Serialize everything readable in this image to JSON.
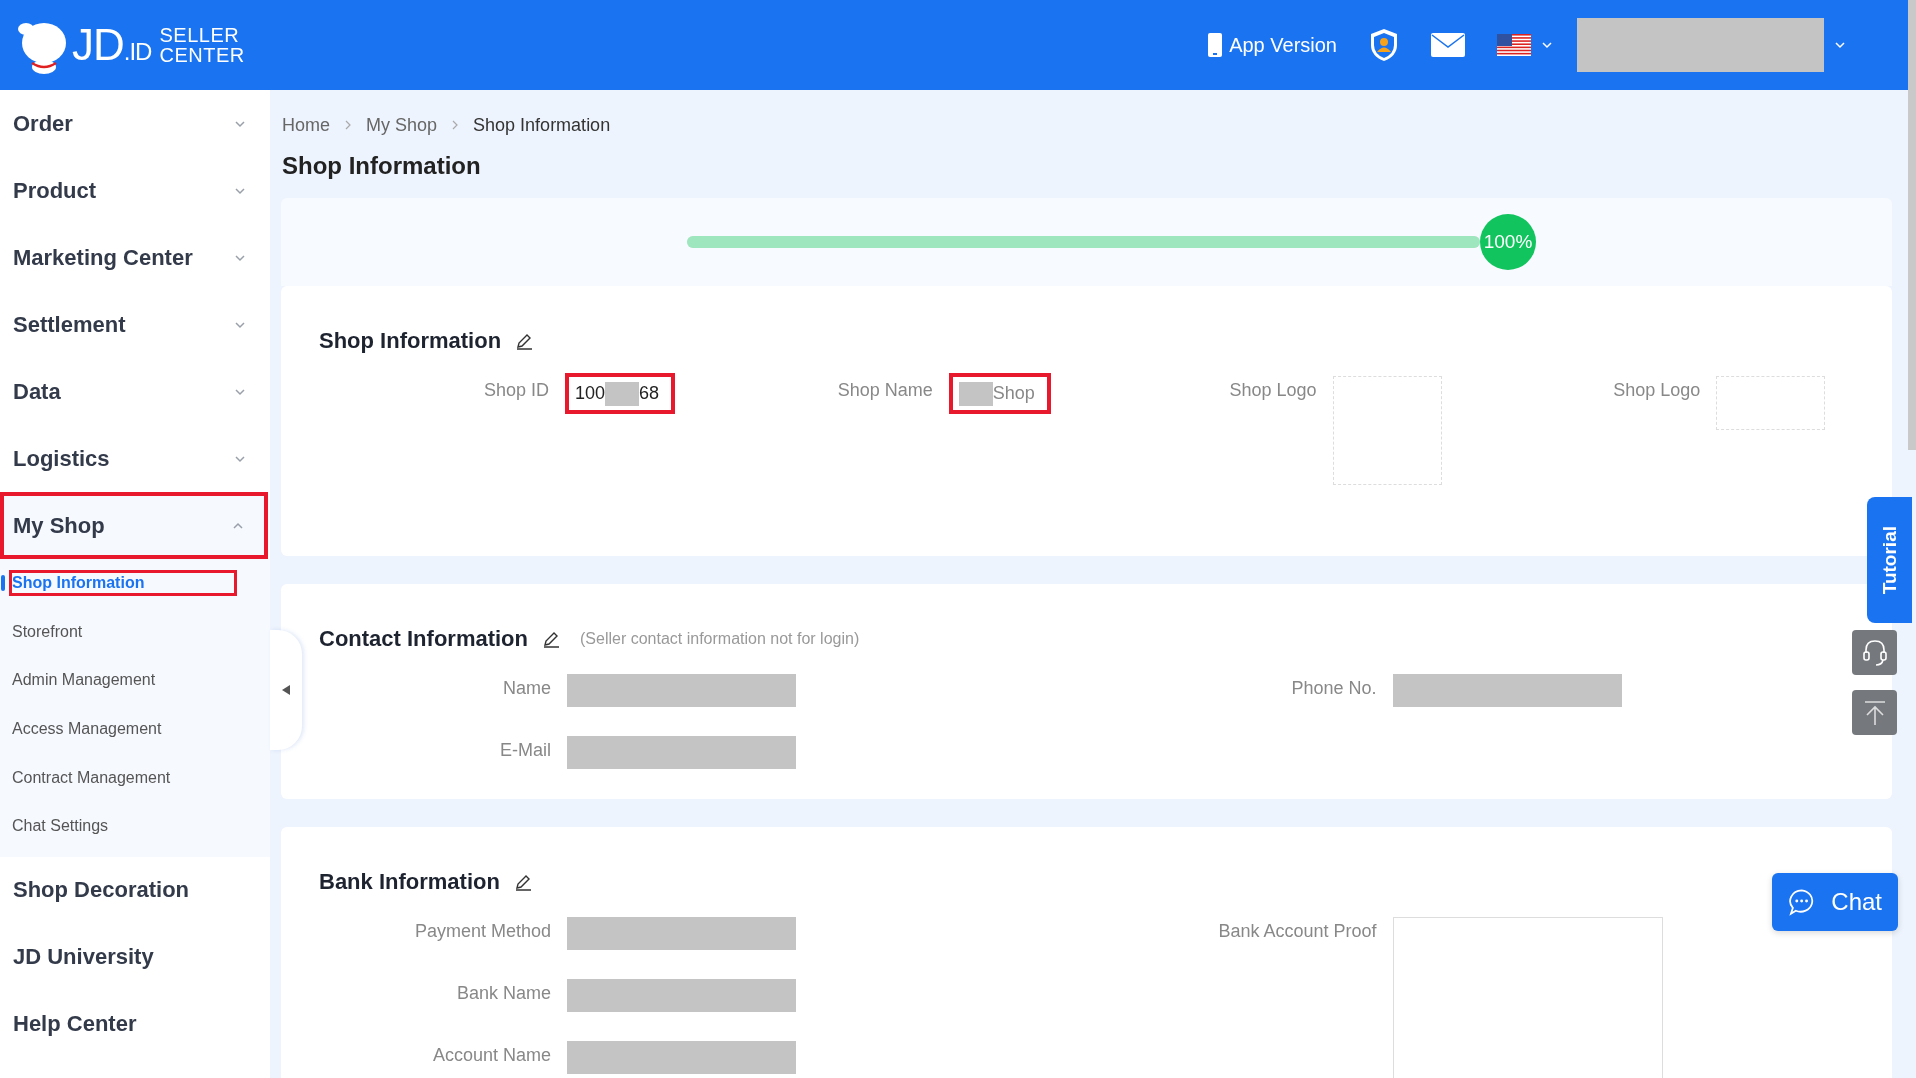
{
  "header": {
    "logo": {
      "brand": "JD",
      "suffix": ".ID",
      "line1": "SELLER",
      "line2": "CENTER"
    },
    "app_version": "App Version"
  },
  "sidebar": {
    "items": [
      {
        "label": "Order",
        "expanded": false,
        "highlighted": false
      },
      {
        "label": "Product",
        "expanded": false,
        "highlighted": false
      },
      {
        "label": "Marketing Center",
        "expanded": false,
        "highlighted": false
      },
      {
        "label": "Settlement",
        "expanded": false,
        "highlighted": false
      },
      {
        "label": "Data",
        "expanded": false,
        "highlighted": false
      },
      {
        "label": "Logistics",
        "expanded": false,
        "highlighted": false
      },
      {
        "label": "My Shop",
        "expanded": true,
        "highlighted": true,
        "children": [
          {
            "label": "Shop Information",
            "selected": true,
            "highlighted": true
          },
          {
            "label": "Storefront",
            "selected": false,
            "highlighted": false
          },
          {
            "label": "Admin Management",
            "selected": false,
            "highlighted": false
          },
          {
            "label": "Access Management",
            "selected": false,
            "highlighted": false
          },
          {
            "label": "Contract Management",
            "selected": false,
            "highlighted": false
          },
          {
            "label": "Chat Settings",
            "selected": false,
            "highlighted": false
          }
        ]
      },
      {
        "label": "Shop Decoration",
        "highlighted": false
      },
      {
        "label": "JD University",
        "highlighted": false
      },
      {
        "label": "Help Center",
        "highlighted": false
      }
    ]
  },
  "breadcrumb": [
    "Home",
    "My Shop",
    "Shop Information"
  ],
  "page_title": "Shop Information",
  "progress": {
    "level": 1,
    "label": "100%"
  },
  "sections": [
    {
      "title": "Shop Information",
      "columns": [
        [
          {
            "label": "Shop ID",
            "highlighted": true,
            "parts": [
              {
                "kind": "text",
                "text": "100"
              },
              {
                "kind": "redacted"
              },
              {
                "kind": "text",
                "text": "68"
              }
            ]
          }
        ],
        [
          {
            "label": "Shop Name",
            "highlighted": true,
            "parts": [
              {
                "kind": "redacted"
              },
              {
                "kind": "muted",
                "text": "Shop"
              }
            ]
          }
        ],
        [
          {
            "label": "Shop Logo",
            "highlighted": false,
            "parts": [
              {
                "kind": "logo"
              }
            ]
          }
        ],
        [
          {
            "label": "Shop Logo",
            "highlighted": false,
            "parts": [
              {
                "kind": "banner"
              }
            ]
          }
        ]
      ]
    },
    {
      "title": "Contact Information",
      "note": "(Seller contact information not for login)",
      "columns": [
        [
          {
            "label": "Name",
            "highlighted": false,
            "parts": [
              {
                "kind": "block"
              }
            ]
          },
          {
            "label": "E-Mail",
            "highlighted": false,
            "parts": [
              {
                "kind": "block"
              }
            ]
          }
        ],
        [
          {
            "label": "Phone No.",
            "highlighted": false,
            "parts": [
              {
                "kind": "block"
              }
            ]
          }
        ]
      ]
    },
    {
      "title": "Bank Information",
      "columns": [
        [
          {
            "label": "Payment Method",
            "highlighted": false,
            "parts": [
              {
                "kind": "block"
              }
            ]
          },
          {
            "label": "Bank Name",
            "highlighted": false,
            "parts": [
              {
                "kind": "block"
              }
            ]
          },
          {
            "label": "Account Name",
            "highlighted": false,
            "parts": [
              {
                "kind": "block"
              }
            ]
          }
        ],
        [
          {
            "label": "Bank Account Proof",
            "highlighted": false,
            "parts": [
              {
                "kind": "document"
              }
            ]
          }
        ]
      ]
    }
  ],
  "side_tools": {
    "tutorial": "Tutorial",
    "chat": "Chat"
  }
}
